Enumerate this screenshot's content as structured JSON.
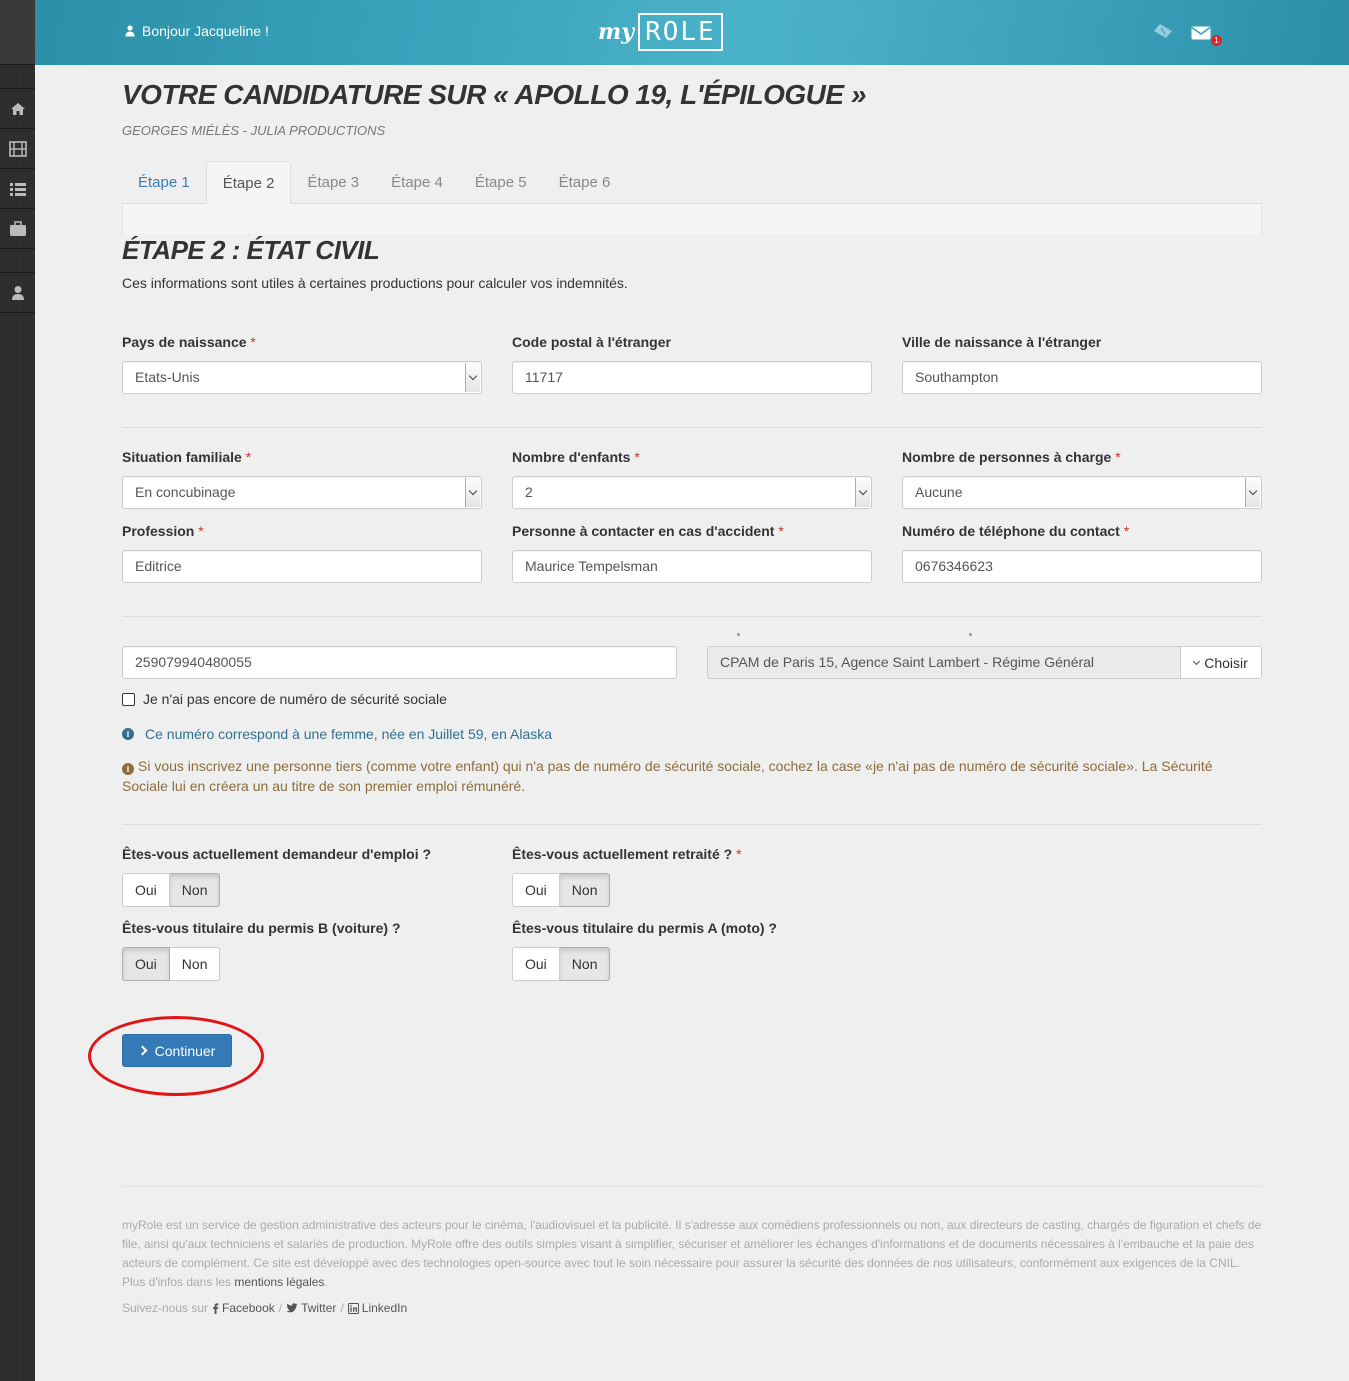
{
  "header": {
    "greeting": "Bonjour Jacqueline !",
    "logo_my": "my",
    "logo_role": "ROLE",
    "notification_count": "1"
  },
  "page": {
    "title": "VOTRE CANDIDATURE SUR « APOLLO 19, L'ÉPILOGUE »",
    "subtitle": "GEORGES MIÉLÈS - JULIA PRODUCTIONS"
  },
  "tabs": [
    {
      "label": "Étape 1"
    },
    {
      "label": "Étape 2"
    },
    {
      "label": "Étape 3"
    },
    {
      "label": "Étape 4"
    },
    {
      "label": "Étape 5"
    },
    {
      "label": "Étape 6"
    }
  ],
  "step": {
    "title": "ÉTAPE 2 : ÉTAT CIVIL",
    "description": "Ces informations sont utiles à certaines productions pour calculer vos indemnités."
  },
  "fields": {
    "pays": {
      "label": "Pays de naissance",
      "value": "Etats-Unis"
    },
    "code_postal": {
      "label": "Code postal à l'étranger",
      "value": "11717"
    },
    "ville": {
      "label": "Ville de naissance à l'étranger",
      "value": "Southampton"
    },
    "situation": {
      "label": "Situation familiale",
      "value": "En concubinage"
    },
    "enfants": {
      "label": "Nombre d'enfants",
      "value": "2"
    },
    "personnes": {
      "label": "Nombre de personnes à charge",
      "value": "Aucune"
    },
    "profession": {
      "label": "Profession",
      "value": "Editrice"
    },
    "contact": {
      "label": "Personne à contacter en cas d'accident",
      "value": "Maurice Tempelsman"
    },
    "telephone": {
      "label": "Numéro de téléphone du contact",
      "value": "0676346623"
    }
  },
  "required_mark": "*",
  "securite_sociale": {
    "number": "259079940480055",
    "caisse": "CPAM de Paris 15, Agence Saint Lambert - Régime Général",
    "choose_label": "Choisir",
    "no_number_label": "Je n'ai pas encore de numéro de sécurité sociale",
    "info_text": "Ce numéro correspond à une femme, née en Juillet 59, en Alaska",
    "warning_text": "Si vous inscrivez une personne tiers (comme votre enfant) qui n'a pas de numéro de sécurité sociale, cochez la case «je n'ai pas de numéro de sécurité sociale». La Sécurité Sociale lui en créera un au titre de son premier emploi rémunéré."
  },
  "questions": {
    "yes_label": "Oui",
    "no_label": "Non",
    "demandeur": {
      "label": "Êtes-vous actuellement demandeur d'emploi ?",
      "selected": "Non"
    },
    "retraite": {
      "label": "Êtes-vous actuellement retraité ?",
      "selected": "Non"
    },
    "permis_b": {
      "label": "Êtes-vous titulaire du permis B (voiture) ?",
      "selected": "Oui"
    },
    "permis_a": {
      "label": "Êtes-vous titulaire du permis A (moto) ?",
      "selected": "Non"
    }
  },
  "continue_label": "Continuer",
  "footer": {
    "text": "myRole est un service de gestion administrative des acteurs pour le cinéma, l'audiovisuel et la publicité. Il s'adresse aux comédiens professionnels ou non, aux directeurs de casting, chargés de figuration et chefs de file, ainsi qu'aux techniciens et salariés de production. MyRole offre des outils simples visant à simplifier, sécuriser et améliorer les échanges d'informations et de documents nécessaires à l'embauche et la paie des acteurs de complément. Ce site est développé avec des technologies open-source avec tout le soin nécessaire pour assurer la sécurité des données de nos utilisateurs, conformément aux exigences de la CNIL. Plus d'infos dans les",
    "legal_link": "mentions légales",
    "period": ".",
    "follow_label": "Suivez-nous sur",
    "separator": "/",
    "facebook": "Facebook",
    "twitter": "Twitter",
    "linkedin": "LinkedIn"
  }
}
